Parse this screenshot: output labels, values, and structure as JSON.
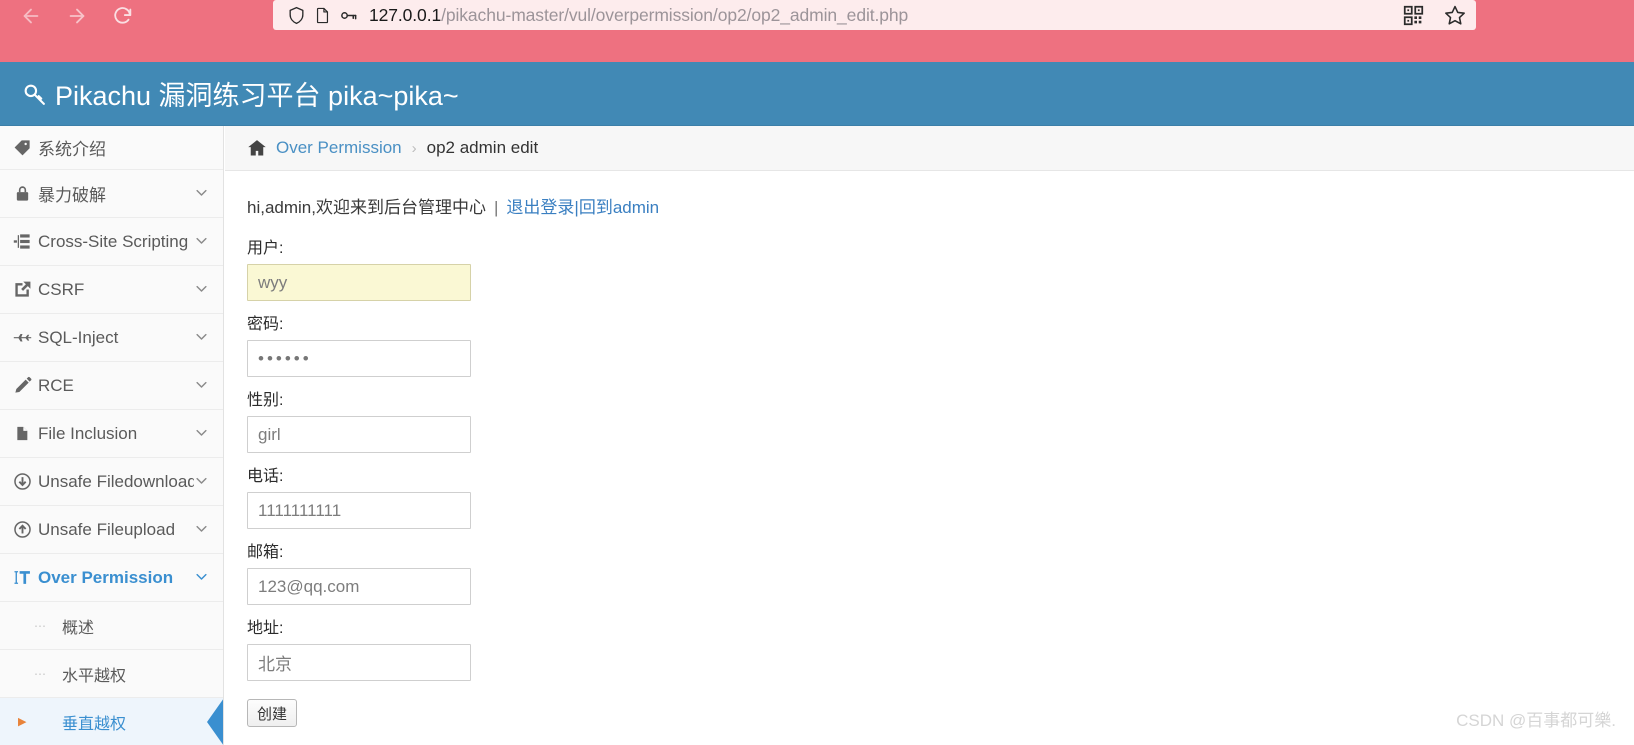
{
  "browser": {
    "back_label": "back-arrow",
    "forward_label": "forward-arrow",
    "reload_label": "reload",
    "url_host": "127.0.0.1",
    "url_path": "/pikachu-master/vul/overpermission/op2/op2_admin_edit.php",
    "url_full": "127.0.0.1/pikachu-master/vul/overpermission/op2/op2_admin_edit.php",
    "shield_icon": "shield-icon",
    "page_icon": "page-icon",
    "key_icon": "key-icon",
    "qr_icon": "qr-code-icon",
    "bookmark_icon": "star-bookmark-icon"
  },
  "header": {
    "icon": "key-search-icon",
    "title": "Pikachu 漏洞练习平台 pika~pika~"
  },
  "sidebar": {
    "items": [
      {
        "label": "系统介绍",
        "icon": "tag-icon",
        "caret": false,
        "active": false
      },
      {
        "label": "暴力破解",
        "icon": "lock-icon",
        "caret": true,
        "active": false
      },
      {
        "label": "Cross-Site Scripting",
        "icon": "sitemap-icon",
        "caret": true,
        "active": false
      },
      {
        "label": "CSRF",
        "icon": "external-link-icon",
        "caret": true,
        "active": false
      },
      {
        "label": "SQL-Inject",
        "icon": "plane-icon",
        "caret": true,
        "active": false
      },
      {
        "label": "RCE",
        "icon": "pencil-icon",
        "caret": true,
        "active": false
      },
      {
        "label": "File Inclusion",
        "icon": "file-icon",
        "caret": true,
        "active": false
      },
      {
        "label": "Unsafe Filedownload",
        "icon": "download-circle-icon",
        "caret": true,
        "active": false
      },
      {
        "label": "Unsafe Fileupload",
        "icon": "upload-circle-icon",
        "caret": true,
        "active": false
      },
      {
        "label": "Over Permission",
        "icon": "text-height-icon",
        "caret": true,
        "active": true
      }
    ],
    "sub_items": [
      {
        "label": "概述",
        "current": false
      },
      {
        "label": "水平越权",
        "current": false
      },
      {
        "label": "垂直越权",
        "current": true
      }
    ],
    "caret_glyph": "⌄"
  },
  "breadcrumb": {
    "home_icon": "home-icon",
    "root": "Over Permission",
    "separator": "›",
    "current": "op2 admin edit"
  },
  "content": {
    "welcome_text": "hi,admin,欢迎来到后台管理中心",
    "welcome_pipe": "|",
    "logout_link": "退出登录",
    "slash": "|",
    "back_link": "回到admin",
    "fields": [
      {
        "label": "用户:",
        "value": "wyy",
        "type": "text",
        "autofill": true,
        "name": "username-field"
      },
      {
        "label": "密码:",
        "value": "••••••",
        "type": "text",
        "autofill": false,
        "name": "password-field"
      },
      {
        "label": "性别:",
        "value": "girl",
        "type": "text",
        "autofill": false,
        "name": "gender-field"
      },
      {
        "label": "电话:",
        "value": "1111111111",
        "type": "text",
        "autofill": false,
        "name": "phone-field"
      },
      {
        "label": "邮箱:",
        "value": "123@qq.com",
        "type": "text",
        "autofill": false,
        "name": "email-field"
      },
      {
        "label": "地址:",
        "value": "北京",
        "type": "text",
        "autofill": false,
        "name": "address-field"
      }
    ],
    "submit_label": "创建"
  },
  "watermark": "CSDN @百事都可樂.",
  "colors": {
    "browser_pink": "#ee7180",
    "header_blue": "#4189b5",
    "link_blue": "#3a8fd0",
    "autofill_yellow": "#faf8d4",
    "active_orange": "#e8833a"
  }
}
